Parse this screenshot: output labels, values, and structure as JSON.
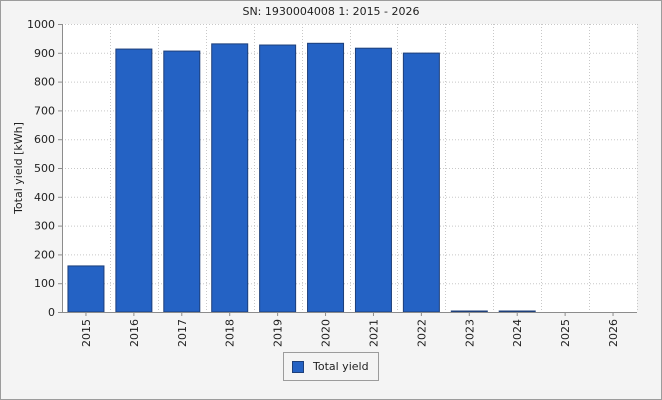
{
  "chart_data": {
    "type": "bar",
    "title": "SN: 1930004008 1: 2015 - 2026",
    "ylabel": "Total yield [kWh]",
    "xlabel": "",
    "categories": [
      "2015",
      "2016",
      "2017",
      "2018",
      "2019",
      "2020",
      "2021",
      "2022",
      "2023",
      "2024",
      "2025",
      "2026"
    ],
    "series": [
      {
        "name": "Total yield",
        "values": [
          160,
          913,
          906,
          931,
          927,
          933,
          916,
          899,
          2,
          2,
          0,
          0
        ]
      }
    ],
    "ylim": [
      0,
      1000
    ],
    "yticks": [
      "0",
      "100",
      "200",
      "300",
      "400",
      "500",
      "600",
      "700",
      "800",
      "900",
      "1000"
    ],
    "grid": true,
    "legend_position": "bottom-center",
    "colors": {
      "bar": "#2462c4",
      "bar_border": "#1d3f7a",
      "grid": "#c8c8c8",
      "axis": "#8c8c8c",
      "frame_background": "#f4f4f4",
      "plot_background": "#ffffff"
    }
  }
}
